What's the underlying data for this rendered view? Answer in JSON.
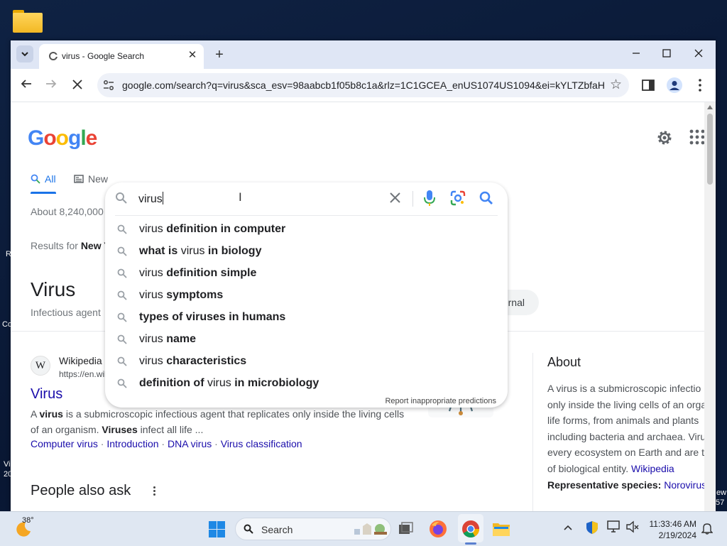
{
  "browser": {
    "tab_title": "virus - Google Search",
    "url": "google.com/search?q=virus&sca_esv=98aabcb1f05b8c1a&rlz=1C1GCEA_enUS1074US1094&ei=kYLTZbfaHf..."
  },
  "google": {
    "logo_letters": [
      {
        "ch": "G",
        "color": "#4285f4"
      },
      {
        "ch": "o",
        "color": "#ea4335"
      },
      {
        "ch": "o",
        "color": "#fbbc05"
      },
      {
        "ch": "g",
        "color": "#4285f4"
      },
      {
        "ch": "l",
        "color": "#34a853"
      },
      {
        "ch": "e",
        "color": "#ea4335"
      }
    ],
    "tabs": [
      {
        "label": "All",
        "active": true
      },
      {
        "label": "New"
      }
    ],
    "about_results": "About 8,240,000",
    "results_for_prefix": "Results for",
    "results_for_place": "New Y",
    "entity_title": "Virus",
    "entity_subtitle": "Infectious agent",
    "chip_label": "rnal"
  },
  "search": {
    "value": "virus",
    "suggestions": [
      {
        "parts": [
          {
            "t": "virus ",
            "b": false
          },
          {
            "t": "definition in computer",
            "b": true
          }
        ]
      },
      {
        "parts": [
          {
            "t": "what is ",
            "b": true
          },
          {
            "t": "virus",
            "b": false
          },
          {
            "t": " in biology",
            "b": true
          }
        ]
      },
      {
        "parts": [
          {
            "t": "virus ",
            "b": false
          },
          {
            "t": "definition simple",
            "b": true
          }
        ]
      },
      {
        "parts": [
          {
            "t": "virus ",
            "b": false
          },
          {
            "t": "symptoms",
            "b": true
          }
        ]
      },
      {
        "parts": [
          {
            "t": "types of viruses in humans",
            "b": true
          }
        ]
      },
      {
        "parts": [
          {
            "t": "virus ",
            "b": false
          },
          {
            "t": "name",
            "b": true
          }
        ]
      },
      {
        "parts": [
          {
            "t": "virus ",
            "b": false
          },
          {
            "t": "characteristics",
            "b": true
          }
        ]
      },
      {
        "parts": [
          {
            "t": "definition of ",
            "b": true
          },
          {
            "t": "virus",
            "b": false
          },
          {
            "t": " in microbiology",
            "b": true
          }
        ]
      }
    ],
    "report_label": "Report inappropriate predictions"
  },
  "result": {
    "site_name": "Wikipedia",
    "site_icon": "W",
    "cite": "https://en.wikipedia.org › wiki › Virus",
    "title": "Virus",
    "snippet_line1_a": "A ",
    "snippet_line1_b": "virus",
    "snippet_line1_c": " is a submicroscopic infectious agent that replicates only inside the living cells",
    "snippet_line2_a": "of an organism. ",
    "snippet_line2_b": "Viruses",
    "snippet_line2_c": " infect all life ...",
    "sitelinks": [
      "Computer virus",
      "Introduction",
      "DNA virus",
      "Virus classification"
    ],
    "sitelink_sep": " · "
  },
  "people_also_ask": "People also ask",
  "about_panel": {
    "heading": "About",
    "lines": [
      "A virus is a submicroscopic infectio",
      "only inside the living cells of an orga",
      "life forms, from animals and plants",
      "including bacteria and archaea. Viru",
      "every ecosystem on Earth and are th"
    ],
    "last_line_prefix": "of biological entity. ",
    "last_line_link": "Wikipedia",
    "rep_label": "Representative species:",
    "rep_value": "Norovirus,"
  },
  "taskbar": {
    "temperature": "38°",
    "search_label": "Search",
    "time": "11:33:46 AM",
    "date": "2/19/2024"
  },
  "desktop_edge": {
    "r": "R",
    "co": "Co",
    "vi": "Vi",
    "n20": "20",
    "ew": "ew",
    "n57": "57"
  }
}
